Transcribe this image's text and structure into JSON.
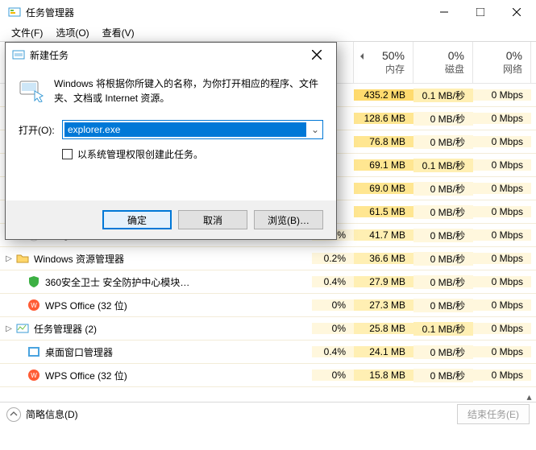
{
  "window": {
    "title": "任务管理器"
  },
  "menu": {
    "file": "文件(F)",
    "options": "选项(O)",
    "view": "查看(V)"
  },
  "columns": {
    "cpu_pct": "",
    "mem_pct": "50%",
    "mem_label": "内存",
    "disk_pct": "0%",
    "disk_label": "磁盘",
    "net_pct": "0%",
    "net_label": "网络"
  },
  "rows": [
    {
      "name": "",
      "cpu": "",
      "mem": "435.2 MB",
      "disk": "0.1 MB/秒",
      "net": "0 Mbps",
      "memHeat": 3,
      "diskHeat": 1
    },
    {
      "name": "",
      "cpu": "",
      "mem": "128.6 MB",
      "disk": "0 MB/秒",
      "net": "0 Mbps",
      "memHeat": 2,
      "diskHeat": 0
    },
    {
      "name": "",
      "cpu": "",
      "mem": "76.8 MB",
      "disk": "0 MB/秒",
      "net": "0 Mbps",
      "memHeat": 2,
      "diskHeat": 0
    },
    {
      "name": "",
      "cpu": "",
      "mem": "69.1 MB",
      "disk": "0.1 MB/秒",
      "net": "0 Mbps",
      "memHeat": 2,
      "diskHeat": 1
    },
    {
      "name": "",
      "cpu": "",
      "mem": "69.0 MB",
      "disk": "0 MB/秒",
      "net": "0 Mbps",
      "memHeat": 2,
      "diskHeat": 0
    },
    {
      "name": "",
      "cpu": "",
      "mem": "61.5 MB",
      "disk": "0 MB/秒",
      "net": "0 Mbps",
      "memHeat": 2,
      "diskHeat": 0
    },
    {
      "name": "Google Chrome",
      "icon": "chrome",
      "cpu": "0%",
      "mem": "41.7 MB",
      "disk": "0 MB/秒",
      "net": "0 Mbps",
      "memHeat": 1,
      "diskHeat": 0
    },
    {
      "name": "Windows 资源管理器",
      "icon": "folder",
      "expand": true,
      "cpu": "0.2%",
      "mem": "36.6 MB",
      "disk": "0 MB/秒",
      "net": "0 Mbps",
      "memHeat": 1,
      "diskHeat": 0
    },
    {
      "name": "360安全卫士 安全防护中心模块…",
      "icon": "shield",
      "cpu": "0.4%",
      "mem": "27.9 MB",
      "disk": "0 MB/秒",
      "net": "0 Mbps",
      "memHeat": 1,
      "diskHeat": 0
    },
    {
      "name": "WPS Office (32 位)",
      "icon": "wps",
      "cpu": "0%",
      "mem": "27.3 MB",
      "disk": "0 MB/秒",
      "net": "0 Mbps",
      "memHeat": 1,
      "diskHeat": 0
    },
    {
      "name": "任务管理器 (2)",
      "icon": "tm",
      "expand": true,
      "cpu": "0%",
      "mem": "25.8 MB",
      "disk": "0.1 MB/秒",
      "net": "0 Mbps",
      "memHeat": 1,
      "diskHeat": 1
    },
    {
      "name": "桌面窗口管理器",
      "icon": "dwm",
      "cpu": "0.4%",
      "mem": "24.1 MB",
      "disk": "0 MB/秒",
      "net": "0 Mbps",
      "memHeat": 1,
      "diskHeat": 0
    },
    {
      "name": "WPS Office (32 位)",
      "icon": "wps",
      "cpu": "0%",
      "mem": "15.8 MB",
      "disk": "0 MB/秒",
      "net": "0 Mbps",
      "memHeat": 1,
      "diskHeat": 0
    }
  ],
  "footer": {
    "less": "简略信息(D)",
    "end": "结束任务(E)"
  },
  "dialog": {
    "title": "新建任务",
    "message": "Windows 将根据你所键入的名称，为你打开相应的程序、文件夹、文档或 Internet 资源。",
    "open_label": "打开(O):",
    "open_value": "explorer.exe",
    "admin_check": "以系统管理权限创建此任务。",
    "ok": "确定",
    "cancel": "取消",
    "browse": "浏览(B)…"
  }
}
